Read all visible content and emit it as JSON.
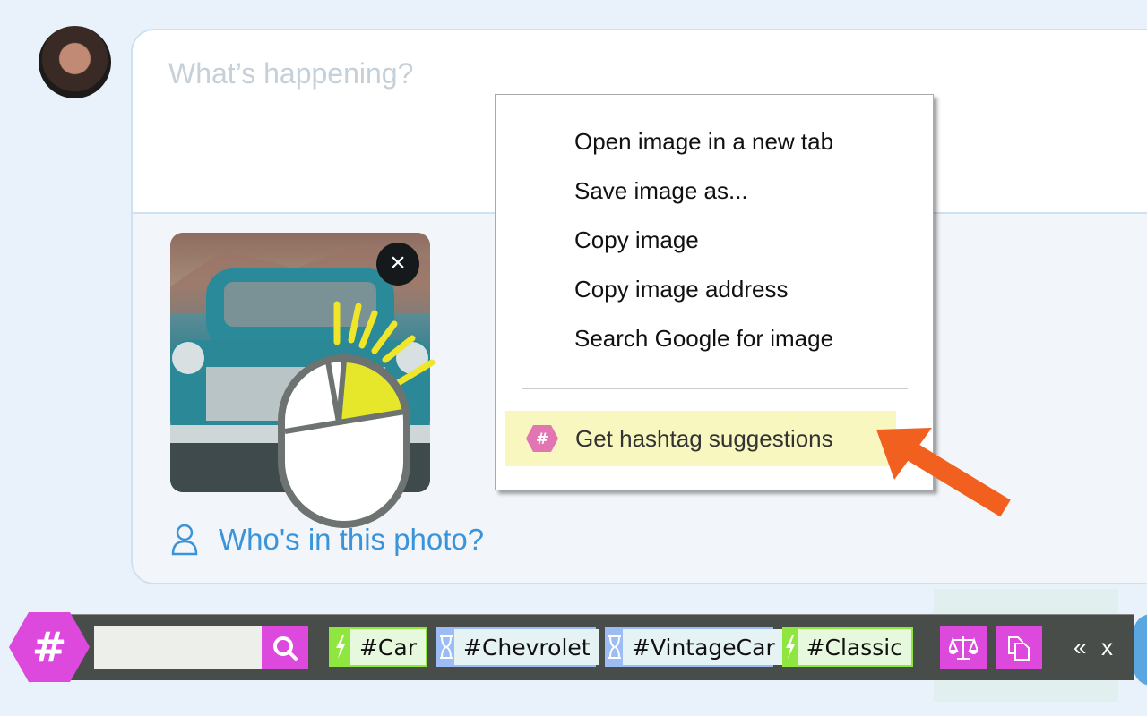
{
  "compose": {
    "placeholder": "What’s happening?",
    "tag_people": "Who's in this photo?"
  },
  "context_menu": {
    "items": [
      "Open image in a new tab",
      "Save image as...",
      "Copy image",
      "Copy image address",
      "Search Google for image"
    ],
    "extension_item": "Get hashtag suggestions",
    "extension_icon": "#"
  },
  "toolbar": {
    "logo": "#",
    "search_value": "",
    "tags": [
      {
        "label": "#Car",
        "kind": "trending",
        "icon": "lightning-icon"
      },
      {
        "label": "#Chevrolet",
        "kind": "pending",
        "icon": "hourglass-icon"
      },
      {
        "label": "#VintageCar",
        "kind": "pending",
        "icon": "hourglass-icon"
      },
      {
        "label": "#Classic",
        "kind": "trending",
        "icon": "lightning-icon"
      }
    ],
    "collapse": "«",
    "close": "x"
  },
  "colors": {
    "accent": "#dd48dd",
    "trending": "#8ee63e",
    "pending": "#9bbcf5",
    "link": "#3b94d9",
    "arrow": "#f2601f",
    "highlight": "#f8f7c0"
  }
}
